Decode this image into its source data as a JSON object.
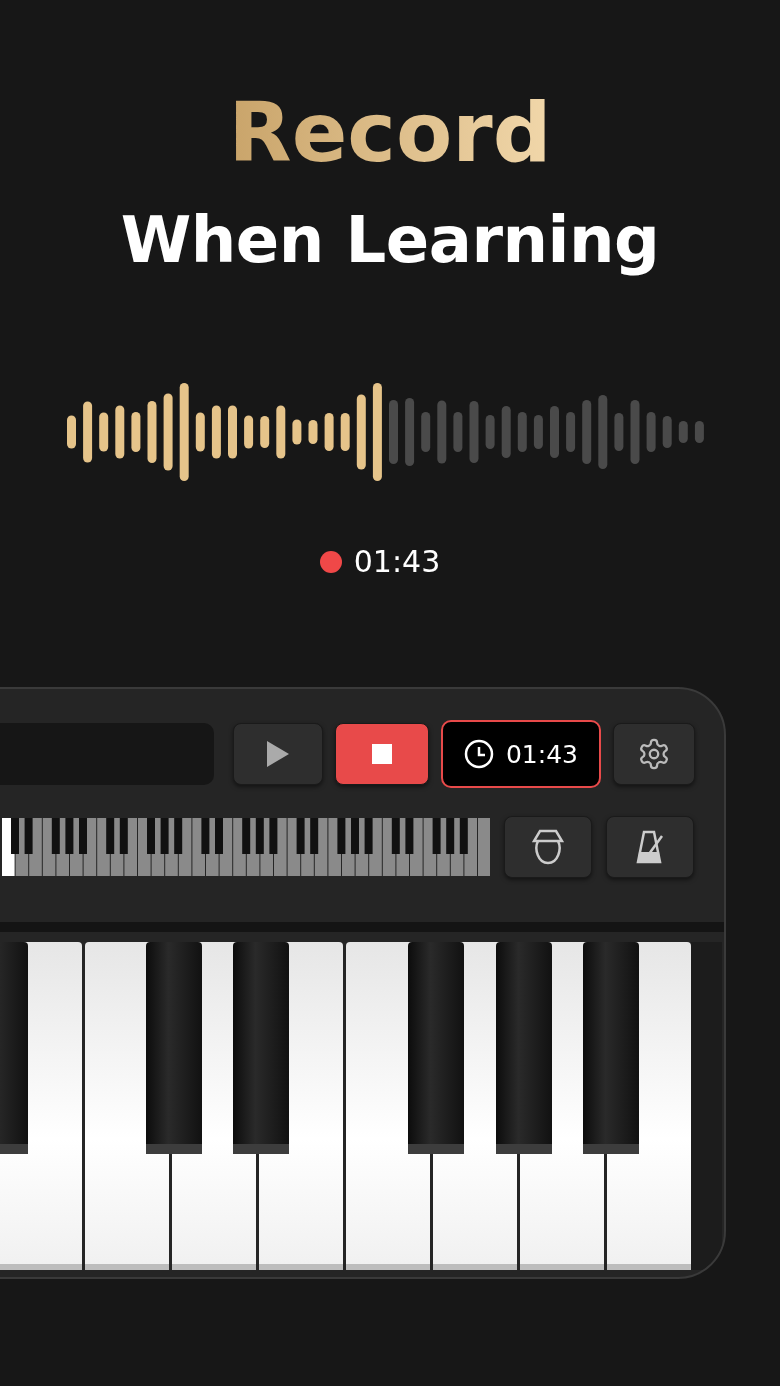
{
  "headline": "Record",
  "subheadline": "When Learning",
  "recording": {
    "active": true,
    "time": "01:43"
  },
  "toolbar": {
    "timer": "01:43"
  }
}
